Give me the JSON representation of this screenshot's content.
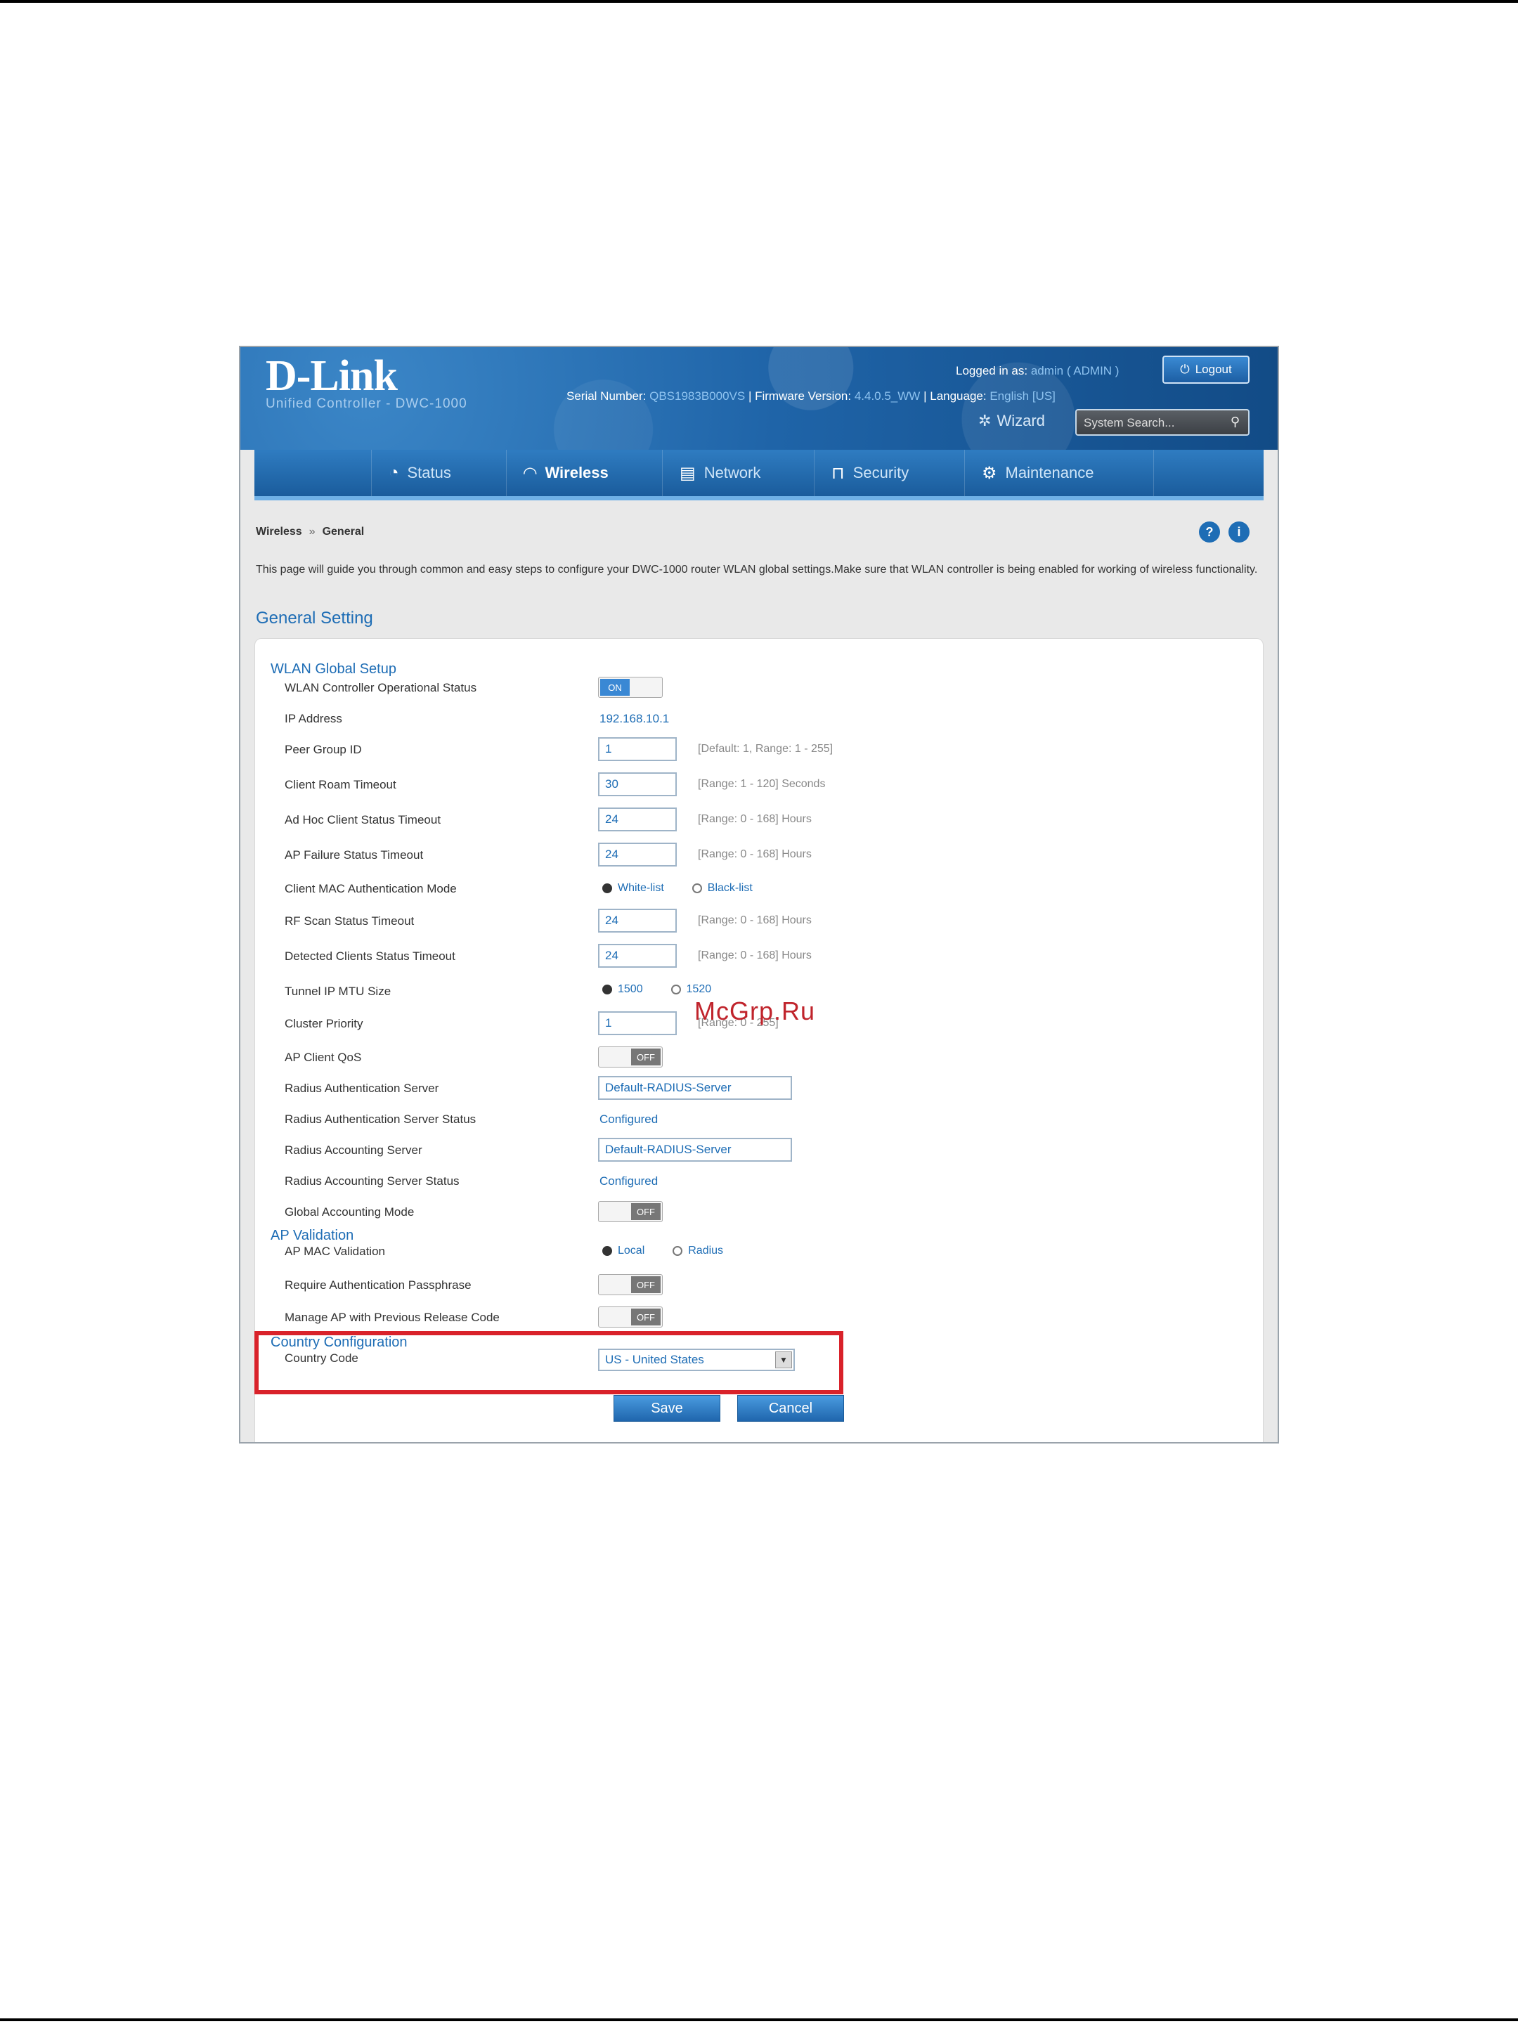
{
  "header": {
    "logo": "D-Link",
    "product": "Unified Controller - DWC-1000",
    "serial_label": "Serial Number:",
    "serial_value": "QBS1983B000VS",
    "firmware_label": "Firmware Version:",
    "firmware_value": "4.4.0.5_WW",
    "language_label": "Language:",
    "language_value": "English [US]",
    "logged_in_label": "Logged in as:",
    "logged_in_value": "admin ( ADMIN )",
    "logout_label": "Logout",
    "wizard_label": "Wizard",
    "search_placeholder": "System Search..."
  },
  "nav": {
    "items": [
      {
        "label": "Status",
        "icon": "gauge-icon"
      },
      {
        "label": "Wireless",
        "icon": "wifi-icon"
      },
      {
        "label": "Network",
        "icon": "network-icon"
      },
      {
        "label": "Security",
        "icon": "lock-icon"
      },
      {
        "label": "Maintenance",
        "icon": "gears-icon"
      }
    ]
  },
  "breadcrumb": {
    "root": "Wireless",
    "sep": "»",
    "current": "General"
  },
  "intro": "This page will guide you through common and easy steps to configure your DWC-1000 router WLAN global settings.Make sure that WLAN controller is being enabled for working of wireless functionality.",
  "section_title": "General Setting",
  "groups": {
    "wlan": "WLAN Global Setup",
    "ap": "AP Validation",
    "country": "Country Configuration"
  },
  "fields": {
    "wlan_status": {
      "label": "WLAN Controller Operational Status",
      "on": "ON"
    },
    "ip_address": {
      "label": "IP Address",
      "value": "192.168.10.1"
    },
    "peer_group": {
      "label": "Peer Group ID",
      "value": "1",
      "hint": "[Default: 1, Range: 1 - 255]"
    },
    "roam_timeout": {
      "label": "Client Roam Timeout",
      "value": "30",
      "hint": "[Range: 1 - 120] Seconds"
    },
    "adhoc_timeout": {
      "label": "Ad Hoc Client Status Timeout",
      "value": "24",
      "hint": "[Range: 0 - 168] Hours"
    },
    "ap_failure": {
      "label": "AP Failure Status Timeout",
      "value": "24",
      "hint": "[Range: 0 - 168] Hours"
    },
    "mac_auth": {
      "label": "Client MAC Authentication Mode",
      "opt1": "White-list",
      "opt2": "Black-list"
    },
    "rf_scan": {
      "label": "RF Scan Status Timeout",
      "value": "24",
      "hint": "[Range: 0 - 168] Hours"
    },
    "detected_clients": {
      "label": "Detected Clients Status Timeout",
      "value": "24",
      "hint": "[Range: 0 - 168] Hours"
    },
    "tunnel_mtu": {
      "label": "Tunnel IP MTU Size",
      "opt1": "1500",
      "opt2": "1520"
    },
    "cluster_priority": {
      "label": "Cluster Priority",
      "value": "1",
      "hint": "[Range: 0 - 255]"
    },
    "ap_qos": {
      "label": "AP Client QoS",
      "off": "OFF"
    },
    "radius_auth": {
      "label": "Radius Authentication Server",
      "value": "Default-RADIUS-Server"
    },
    "radius_auth_status": {
      "label": "Radius Authentication Server Status",
      "value": "Configured"
    },
    "radius_acct": {
      "label": "Radius Accounting Server",
      "value": "Default-RADIUS-Server"
    },
    "radius_acct_status": {
      "label": "Radius Accounting Server Status",
      "value": "Configured"
    },
    "global_acct": {
      "label": "Global Accounting Mode",
      "off": "OFF"
    },
    "ap_mac_validation": {
      "label": "AP MAC Validation",
      "opt1": "Local",
      "opt2": "Radius"
    },
    "require_auth": {
      "label": "Require Authentication Passphrase",
      "off": "OFF"
    },
    "manage_ap": {
      "label": "Manage AP with Previous Release Code",
      "off": "OFF"
    },
    "country_code": {
      "label": "Country Code",
      "value": "US - United States"
    }
  },
  "buttons": {
    "save": "Save",
    "cancel": "Cancel"
  },
  "watermark": "McGrp.Ru",
  "colors": {
    "accent": "#1e6db5",
    "highlight": "#d9222a"
  }
}
